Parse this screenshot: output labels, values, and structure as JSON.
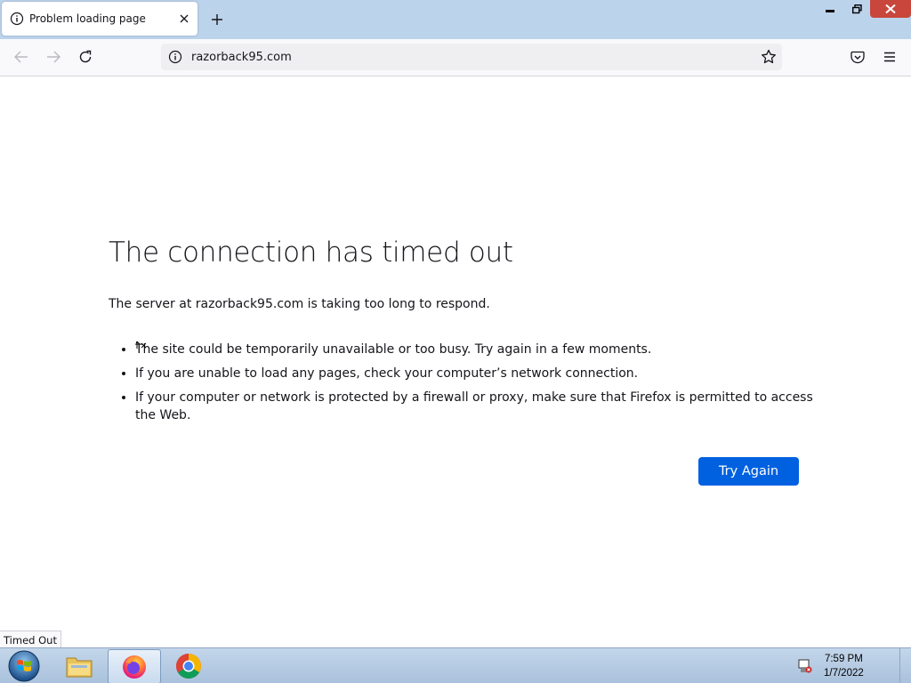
{
  "browser": {
    "tab_title": "Problem loading page",
    "url": "razorback95.com"
  },
  "error": {
    "title": "The connection has timed out",
    "description": "The server at razorback95.com is taking too long to respond.",
    "bullets": [
      "The site could be temporarily unavailable or too busy. Try again in a few moments.",
      "If you are unable to load any pages, check your computer’s network connection.",
      "If your computer or network is protected by a firewall or proxy, make sure that Firefox is permitted to access the Web."
    ],
    "button_label": "Try Again"
  },
  "status_text": "Timed Out",
  "taskbar": {
    "time": "7:59 PM",
    "date": "1/7/2022"
  },
  "colors": {
    "accent": "#0061e0",
    "tabstrip": "#bcd3ec",
    "close": "#c9463d"
  }
}
